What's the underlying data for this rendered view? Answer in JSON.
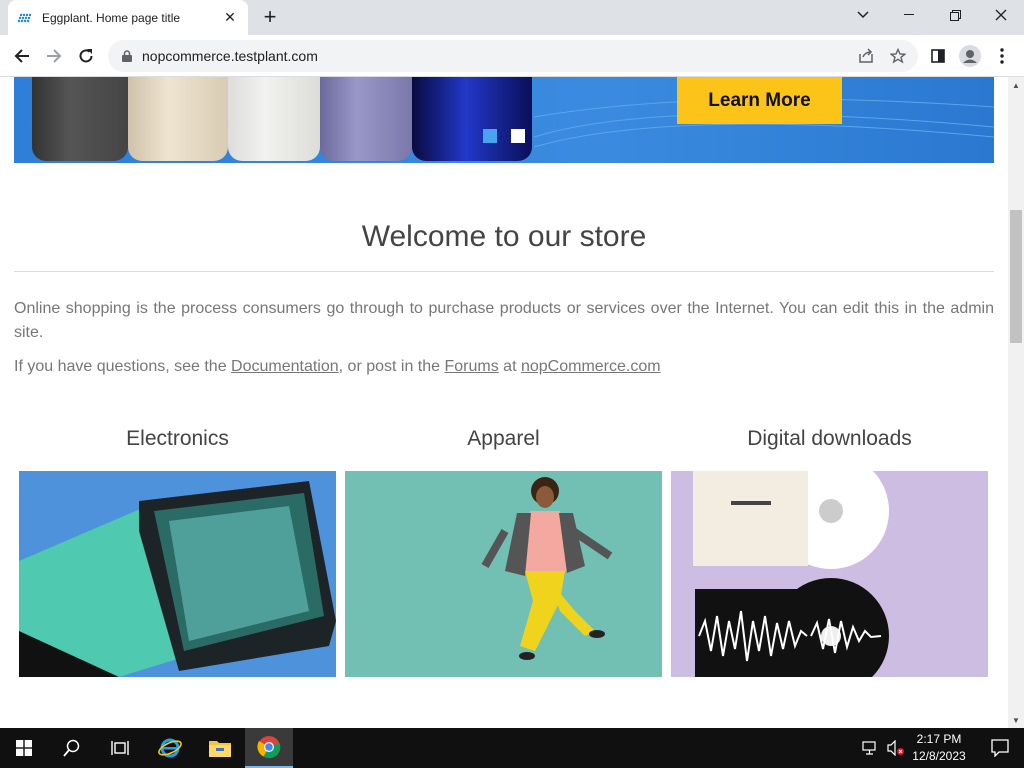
{
  "browser": {
    "tab_title": "Eggplant. Home page title",
    "url": "nopcommerce.testplant.com"
  },
  "banner": {
    "cta_label": "Learn More"
  },
  "page": {
    "heading": "Welcome to our store",
    "intro": "Online shopping is the process consumers go through to purchase products or services over the Internet. You can edit this in the admin site.",
    "questions_prefix": "If you have questions, see the ",
    "documentation_link": "Documentation",
    "questions_middle": ", or post in the ",
    "forums_link": "Forums",
    "questions_at": " at ",
    "site_link": "nopCommerce.com"
  },
  "categories": [
    {
      "name": "Electronics"
    },
    {
      "name": "Apparel"
    },
    {
      "name": "Digital downloads"
    }
  ],
  "taskbar": {
    "time": "2:17 PM",
    "date": "12/8/2023"
  },
  "colors": {
    "accent": "#fcc419",
    "banner_blue": "#2f7fd8",
    "taskbar": "#101010"
  }
}
